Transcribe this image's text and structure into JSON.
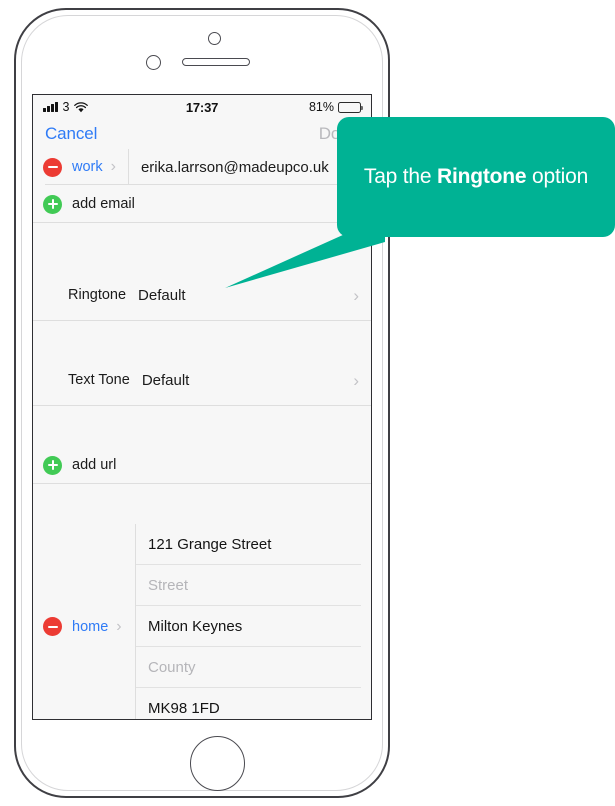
{
  "device": {
    "name": "iPhone",
    "hardware": {
      "front_camera": "camera-icon",
      "proximity_sensor": "sensor-icon",
      "earpiece": "speaker-grille",
      "home_button": "home-button"
    }
  },
  "status_bar": {
    "signal_icon": "signal-bars-icon",
    "signal_bars": 4,
    "carrier": "3",
    "wifi_icon": "wifi-icon",
    "time": "17:37",
    "battery_percent": "81%",
    "battery_level": 81,
    "battery_icon": "battery-icon"
  },
  "nav_bar": {
    "cancel_label": "Cancel",
    "done_label": "Done",
    "cancel_color": "#2f7bf6",
    "done_color": "#b9b9bd"
  },
  "email_row": {
    "delete_icon": "minus-circle-icon",
    "label": "work",
    "chevron_icon": "chevron-right-icon",
    "value": "erika.larrson@madeupco.uk"
  },
  "add_email_row": {
    "add_icon": "plus-circle-icon",
    "label": "add email"
  },
  "ringtone_row": {
    "label": "Ringtone",
    "value": "Default",
    "chevron_icon": "chevron-right-icon"
  },
  "text_tone_row": {
    "label": "Text Tone",
    "value": "Default",
    "chevron_icon": "chevron-right-icon"
  },
  "add_url_row": {
    "add_icon": "plus-circle-icon",
    "label": "add url"
  },
  "address_block": {
    "delete_icon": "minus-circle-icon",
    "label": "home",
    "chevron_icon": "chevron-right-icon",
    "fields": [
      {
        "value": "121 Grange Street",
        "placeholder": "",
        "is_placeholder": false
      },
      {
        "value": "Street",
        "placeholder": "Street",
        "is_placeholder": true
      },
      {
        "value": "Milton Keynes",
        "placeholder": "",
        "is_placeholder": false
      },
      {
        "value": "County",
        "placeholder": "County",
        "is_placeholder": true
      },
      {
        "value": "MK98 1FD",
        "placeholder": "",
        "is_placeholder": false
      }
    ]
  },
  "tooltip": {
    "text_prefix": "Tap the ",
    "text_bold": "Ringtone",
    "text_suffix": " option",
    "background_color": "#00b294",
    "text_color": "#ffffff",
    "points_to": "ringtone-row"
  },
  "colors": {
    "accent_teal": "#00b294",
    "link_blue": "#2f7bf6",
    "delete_red": "#ec3b33",
    "add_green": "#41ca55",
    "screen_bg": "#f7f7f7",
    "hairline": "#dedede",
    "placeholder_gray": "#b5b5b9"
  }
}
